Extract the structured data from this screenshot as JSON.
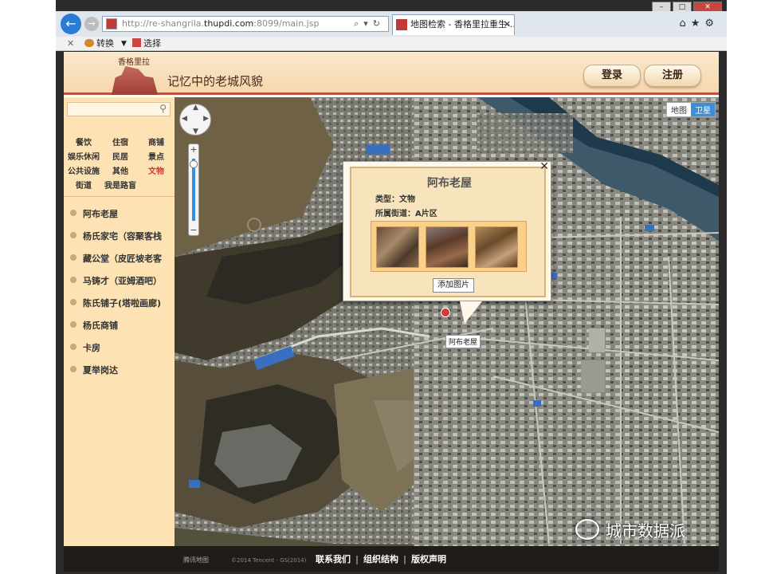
{
  "browser": {
    "url_prefix": "http://re-shangrila.",
    "url_host": "thupdi.com",
    "url_suffix": ":8099/main.jsp",
    "tab_title": "地图检索 - 香格里拉重生-...",
    "command_convert": "转换",
    "command_select": "选择"
  },
  "header": {
    "logo_text": "香格里拉",
    "site_title": "记忆中的老城风貌",
    "login": "登录",
    "register": "注册"
  },
  "sidebar": {
    "categories": [
      {
        "label": "餐饮",
        "active": false
      },
      {
        "label": "住宿",
        "active": false
      },
      {
        "label": "商铺",
        "active": false
      },
      {
        "label": "娱乐休闲",
        "active": false
      },
      {
        "label": "民居",
        "active": false
      },
      {
        "label": "景点",
        "active": false
      },
      {
        "label": "公共设施",
        "active": false
      },
      {
        "label": "其他",
        "active": false
      },
      {
        "label": "文物",
        "active": true
      },
      {
        "label": "街道",
        "active": false
      },
      {
        "label": "我是路盲",
        "active": false
      }
    ],
    "places": [
      "阿布老屋",
      "杨氏家宅（容聚客栈",
      "藏公堂（皮匠坡老客",
      "马铸才（亚姆酒吧）",
      "陈氏铺子(塔啦画廊)",
      "杨氏商铺",
      "卡房",
      "夏举岗达"
    ]
  },
  "map": {
    "type_map": "地图",
    "type_satellite": "卫星",
    "marker_label": "阿布老屋"
  },
  "popup": {
    "title": "阿布老屋",
    "type_line": "类型：文物",
    "street_line": "所属街道：A片区",
    "add_photo": "添加图片"
  },
  "footer": {
    "links": [
      "联系我们",
      "组织结构",
      "版权声明"
    ],
    "separator": "|",
    "map_provider": "腾讯地图",
    "copyright": "©2014 Tencent - GS(2014)"
  },
  "watermark": "城市数据派"
}
